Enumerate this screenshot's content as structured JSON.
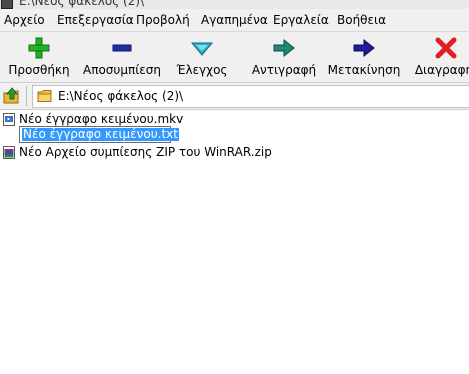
{
  "window": {
    "title": "E:\\Νέος φάκελος (2)\\"
  },
  "menu": {
    "items": [
      {
        "label": "Αρχείο"
      },
      {
        "label": "Επεξεργασία"
      },
      {
        "label": "Προβολή"
      },
      {
        "label": "Αγαπημένα"
      },
      {
        "label": "Εργαλεία"
      },
      {
        "label": "Βοήθεια"
      }
    ]
  },
  "toolbar": {
    "buttons": [
      {
        "label": "Προσθήκη",
        "icon": "plus-icon",
        "color": "#22b022"
      },
      {
        "label": "Αποσυμπίεση",
        "icon": "minus-icon",
        "color": "#1f2fa8"
      },
      {
        "label": "Έλεγχος",
        "icon": "check-chevron-icon",
        "color": "#2bb0c8"
      },
      {
        "label": "Αντιγραφή",
        "icon": "copy-arrow-icon",
        "color": "#1f8a7a"
      },
      {
        "label": "Μετακίνηση",
        "icon": "move-arrow-icon",
        "color": "#1f1f9a"
      },
      {
        "label": "Διαγραφή",
        "icon": "delete-x-icon",
        "color": "#e02020"
      }
    ]
  },
  "address": {
    "path": "E:\\Νέος φάκελος (2)\\"
  },
  "files": [
    {
      "name": "Νέο έγγραφο κειμένου.mkv",
      "icon": "video-file-icon"
    },
    {
      "name": "Νέο έγγραφο κειμένου.txt",
      "icon": "text-file-icon",
      "editing": true
    },
    {
      "name": "Νέο Αρχείο συμπίεσης ZIP του WinRAR.zip",
      "icon": "zip-file-icon"
    }
  ],
  "colors": {
    "selection": "#3399ff",
    "chrome": "#f0f0f0"
  }
}
